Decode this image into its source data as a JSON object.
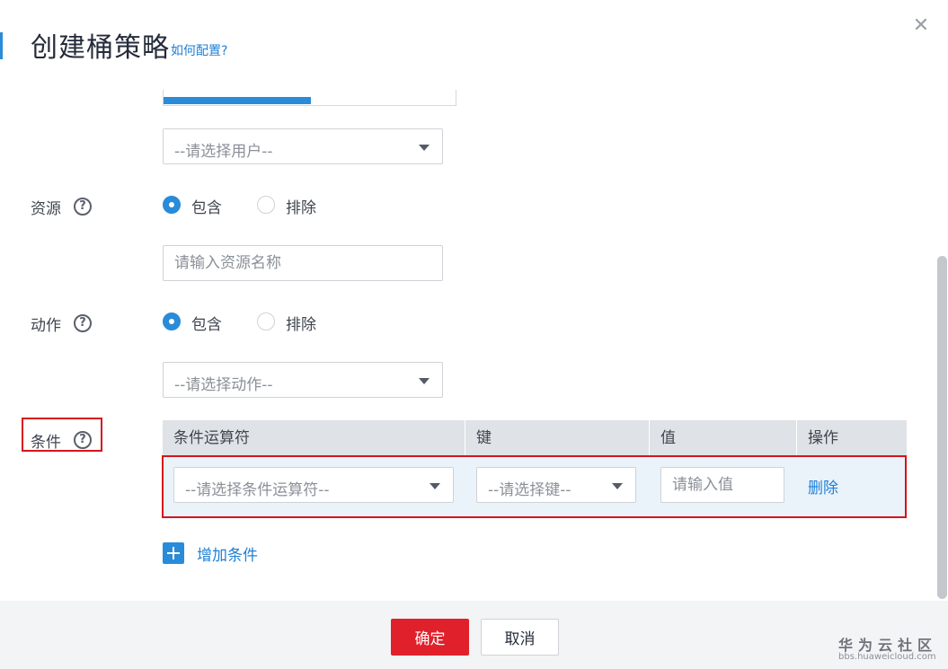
{
  "dialog": {
    "title": "创建桶策略",
    "help_link": "如何配置?",
    "close_icon": "close-icon"
  },
  "user_select": {
    "placeholder": "--请选择用户--"
  },
  "resource": {
    "label": "资源",
    "include": "包含",
    "exclude": "排除",
    "selected": "include",
    "input_placeholder": "请输入资源名称"
  },
  "action": {
    "label": "动作",
    "include": "包含",
    "exclude": "排除",
    "selected": "include",
    "select_placeholder": "--请选择动作--"
  },
  "condition": {
    "label": "条件",
    "columns": [
      "条件运算符",
      "键",
      "值",
      "操作"
    ],
    "row": {
      "operator_placeholder": "--请选择条件运算符--",
      "key_placeholder": "--请选择键--",
      "value_placeholder": "请输入值",
      "delete": "删除"
    },
    "add_label": "增加条件"
  },
  "footer": {
    "ok": "确定",
    "cancel": "取消"
  },
  "watermark": {
    "title": "华为云社区",
    "url": "bbs.huaweicloud.com"
  },
  "colors": {
    "accent": "#2a8bd8",
    "primary_button": "#e0202a",
    "highlight_border": "#d4141c"
  }
}
